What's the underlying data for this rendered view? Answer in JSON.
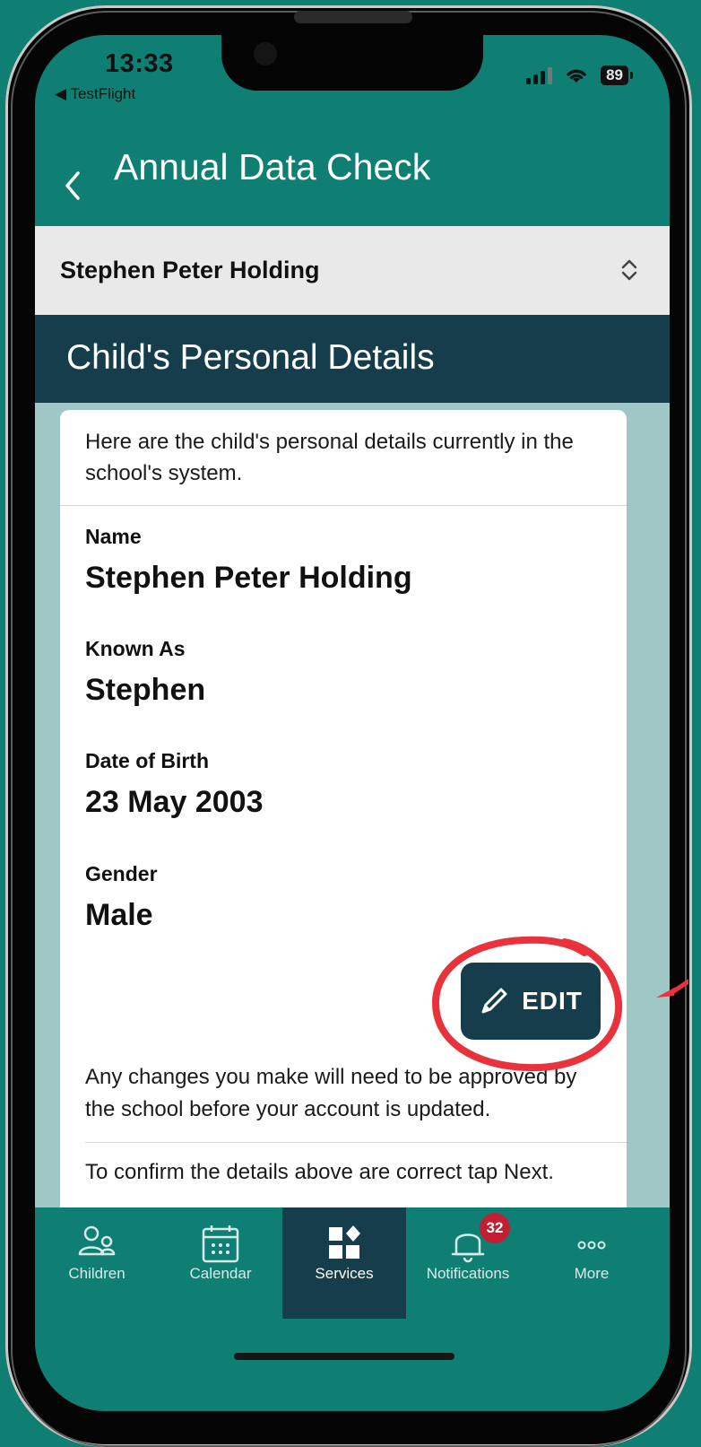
{
  "status_bar": {
    "time": "13:33",
    "back_app": "◀ TestFlight",
    "battery": "89",
    "icons": [
      "signal-icon",
      "wifi-icon",
      "battery-icon"
    ]
  },
  "header": {
    "back_icon": "chevron-left-icon",
    "title": "Annual Data Check"
  },
  "child_selector": {
    "selected": "Stephen Peter Holding",
    "icon": "up-down-chevron-icon"
  },
  "section": {
    "title": "Child's Personal Details"
  },
  "card": {
    "intro": "Here are the child's personal details currently in the school's system.",
    "fields": [
      {
        "label": "Name",
        "value": "Stephen Peter Holding"
      },
      {
        "label": "Known As",
        "value": "Stephen"
      },
      {
        "label": "Date of Birth",
        "value": "23 May 2003"
      },
      {
        "label": "Gender",
        "value": "Male"
      }
    ],
    "edit_button": "EDIT",
    "note": "Any changes you make will need to be approved by the school before your account is updated.",
    "confirm": "To confirm the details above are correct tap Next."
  },
  "tabbar": {
    "tabs": [
      {
        "label": "Children",
        "icon": "children-icon"
      },
      {
        "label": "Calendar",
        "icon": "calendar-icon"
      },
      {
        "label": "Services",
        "icon": "services-icon",
        "active": true
      },
      {
        "label": "Notifications",
        "icon": "bell-icon",
        "badge": "32"
      },
      {
        "label": "More",
        "icon": "more-icon"
      }
    ]
  },
  "colors": {
    "brand_teal": "#0f7f74",
    "dark_navy": "#163d4b",
    "badge_red": "#c21f35",
    "annotation_red": "#e8333c"
  }
}
